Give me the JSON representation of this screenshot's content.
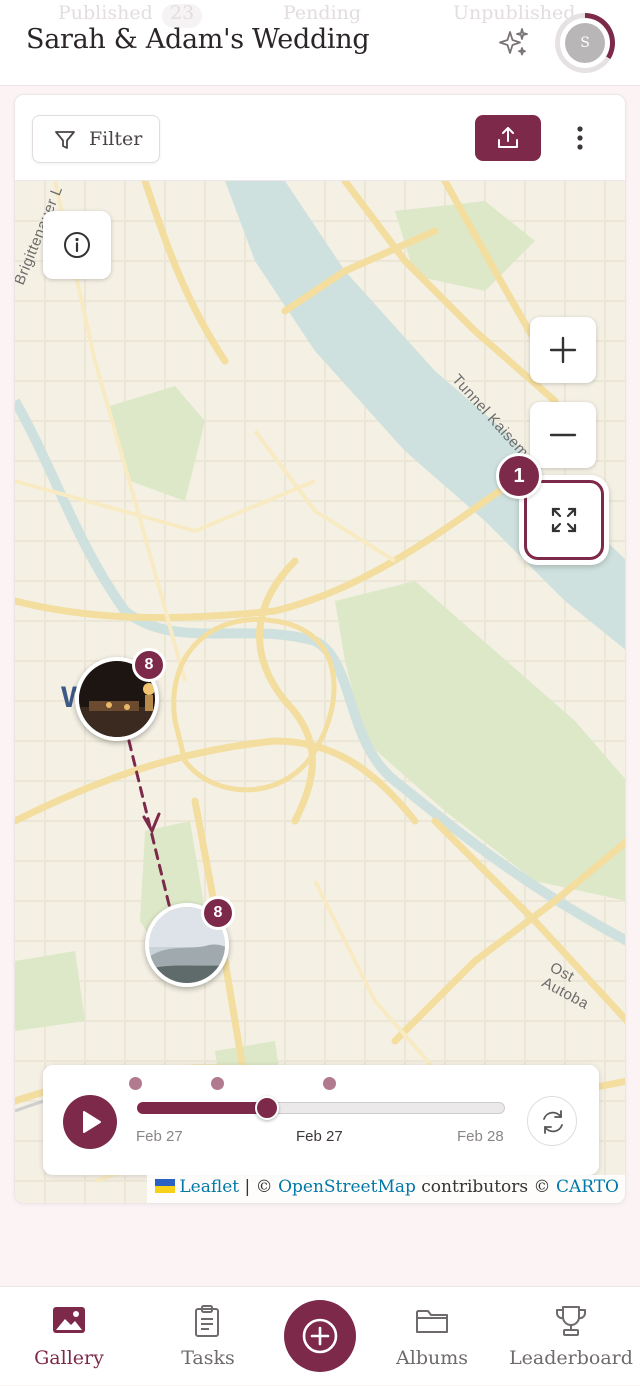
{
  "header": {
    "title": "Sarah & Adam's Wedding",
    "tabs": [
      {
        "label": "Published",
        "count": "23"
      },
      {
        "label": "Pending"
      },
      {
        "label": "Unpublished"
      }
    ],
    "avatar_initial": "S",
    "sparkle_icon": "sparkle-icon"
  },
  "toolbar": {
    "filter_label": "Filter",
    "upload_icon": "upload-icon",
    "more_icon": "more-vertical-icon"
  },
  "map": {
    "labels": {
      "bridge": "Brigittenauer L",
      "tunnel": "Tunnel Kaisem",
      "autobahn": "Ost Autoba",
      "district": "W"
    },
    "controls": {
      "info_icon": "info-icon",
      "zoom_in_icon": "plus-icon",
      "zoom_out_icon": "minus-icon",
      "fullscreen_icon": "fullscreen-icon"
    },
    "step_badge": "1",
    "clusters": [
      {
        "count": "8"
      },
      {
        "count": "8"
      }
    ],
    "attribution": {
      "leaflet": "Leaflet",
      "separator": " | © ",
      "osm": "OpenStreetMap",
      "contributors": " contributors © ",
      "carto": "CARTO"
    }
  },
  "timeline": {
    "progress": 0.35,
    "labels": [
      "Feb 27",
      "Feb 27",
      "Feb 28"
    ],
    "play_icon": "play-icon",
    "reset_icon": "refresh-icon"
  },
  "nav": {
    "items": [
      {
        "label": "Gallery",
        "icon": "image-icon",
        "active": true
      },
      {
        "label": "Tasks",
        "icon": "clipboard-icon"
      },
      {
        "label": "Albums",
        "icon": "folder-icon"
      },
      {
        "label": "Leaderboard",
        "icon": "trophy-icon"
      }
    ],
    "fab_icon": "add-circle-icon"
  },
  "colors": {
    "accent": "#7d2a4a",
    "map_land": "#f4f0e4",
    "map_water": "#cfe1de",
    "map_park": "#dde8c8",
    "map_road": "#f6e3a0"
  }
}
